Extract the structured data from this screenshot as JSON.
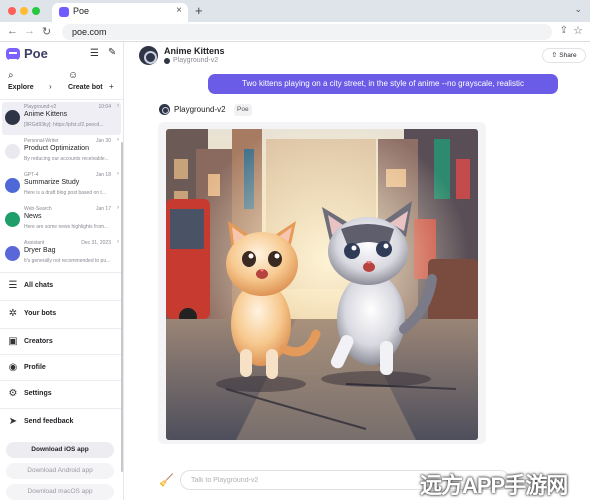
{
  "browser": {
    "tab_title": "Poe",
    "tab_close": "×",
    "new_tab": "+",
    "tab_chevron": "⌄",
    "url": "poe.com"
  },
  "sidebar": {
    "logo_text": "Poe",
    "explore_label": "Explore",
    "create_label": "Create bot",
    "conversations": [
      {
        "bot": "Playground-v2",
        "date": "10:04",
        "title": "Anime Kittens",
        "preview": "[9RGd93ky]: https://pfst.cf2.poecd...",
        "avatar_color": "#2f3545",
        "active": true
      },
      {
        "bot": "Personal-Writer",
        "date": "Jan 30",
        "title": "Product Optimization",
        "preview": "By reducing our accounts receivable...",
        "avatar_color": "#e9e9ef",
        "active": false
      },
      {
        "bot": "GPT-4",
        "date": "Jan 18",
        "title": "Summarize Study",
        "preview": "Here is a draft blog post based on t...",
        "avatar_color": "#4e68d8",
        "active": false
      },
      {
        "bot": "Web-Search",
        "date": "Jan 17",
        "title": "News",
        "preview": "Here are some news highlights from...",
        "avatar_color": "#1f9e6b",
        "active": false
      },
      {
        "bot": "Assistant",
        "date": "Dec 31, 2023",
        "title": "Dryer Bag",
        "preview": "It's generally not recommended to pu...",
        "avatar_color": "#5a67d8",
        "active": false
      }
    ],
    "nav": [
      {
        "label": "All chats",
        "icon": "☰",
        "icon_name": "all-chats-icon"
      },
      {
        "label": "Your bots",
        "icon": "✲",
        "icon_name": "your-bots-icon"
      },
      {
        "label": "Creators",
        "icon": "▣",
        "icon_name": "creators-icon"
      },
      {
        "label": "Profile",
        "icon": "◉",
        "icon_name": "profile-icon"
      },
      {
        "label": "Settings",
        "icon": "⚙",
        "icon_name": "settings-icon"
      },
      {
        "label": "Send feedback",
        "icon": "➤",
        "icon_name": "send-feedback-icon"
      }
    ],
    "apps": {
      "ios": "Download iOS app",
      "android": "Download Android app",
      "mac": "Download macOS app"
    }
  },
  "chat": {
    "bot_name": "Anime Kittens",
    "bot_sub": "Playground-v2",
    "share_label": "Share",
    "user_message": "Two kittens playing on a city street, in the style of anime --no grayscale, realistic",
    "reply_bot": "Playground-v2",
    "reply_tag": "Poe",
    "input_placeholder": "Talk to Playground-v2"
  },
  "watermark": "远方APP手游网",
  "colors": {
    "accent": "#6b5ce7",
    "logo": "#7b61ff"
  }
}
